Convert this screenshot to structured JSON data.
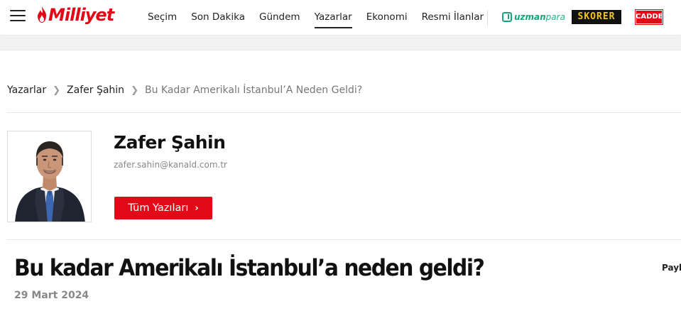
{
  "header": {
    "logo_text": "Milliyet",
    "nav": [
      {
        "label": "Seçim",
        "active": false
      },
      {
        "label": "Son Dakika",
        "active": false
      },
      {
        "label": "Gündem",
        "active": false
      },
      {
        "label": "Yazarlar",
        "active": true
      },
      {
        "label": "Ekonomi",
        "active": false
      },
      {
        "label": "Resmi İlanlar",
        "active": false
      }
    ],
    "brands": {
      "uzman_main": "uzman",
      "uzman_suffix": "para",
      "skorer": "SKORER",
      "cadde": "CADDE"
    }
  },
  "breadcrumb": {
    "items": [
      "Yazarlar",
      "Zafer Şahin"
    ],
    "current": "Bu Kadar Amerikalı İstanbul’A Neden Geldi?"
  },
  "author": {
    "name": "Zafer Şahin",
    "email": "zafer.sahin@kanald.com.tr",
    "all_posts_label": "Tüm Yazıları"
  },
  "article": {
    "title": "Bu kadar Amerikalı İstanbul’a neden geldi?",
    "date": "29 Mart 2024",
    "share_label": "Payl"
  },
  "colors": {
    "brand_red": "#e30a17",
    "uzman_green": "#1aa37a",
    "skorer_yellow": "#f4c51b"
  }
}
